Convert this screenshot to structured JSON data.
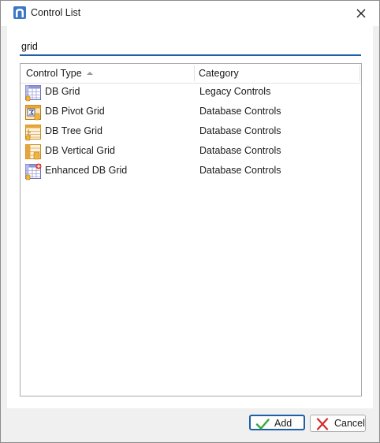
{
  "window": {
    "title": "Control List"
  },
  "search": {
    "value": "grid"
  },
  "list": {
    "columns": {
      "type": "Control Type",
      "category": "Category"
    },
    "rows": [
      {
        "name": "DB Grid",
        "category": "Legacy Controls",
        "icon": "db-grid-icon"
      },
      {
        "name": "DB Pivot Grid",
        "category": "Database Controls",
        "icon": "db-pivot-grid-icon"
      },
      {
        "name": "DB Tree Grid",
        "category": "Database Controls",
        "icon": "db-tree-grid-icon"
      },
      {
        "name": "DB Vertical Grid",
        "category": "Database Controls",
        "icon": "db-vertical-grid-icon"
      },
      {
        "name": "Enhanced DB Grid",
        "category": "Database Controls",
        "icon": "enhanced-db-grid-icon"
      }
    ]
  },
  "buttons": {
    "add": "Add",
    "cancel": "Cancel"
  },
  "colors": {
    "accent": "#1f5fa6",
    "cancel_x": "#d42a2a",
    "ok_check": "#3aa53a"
  }
}
